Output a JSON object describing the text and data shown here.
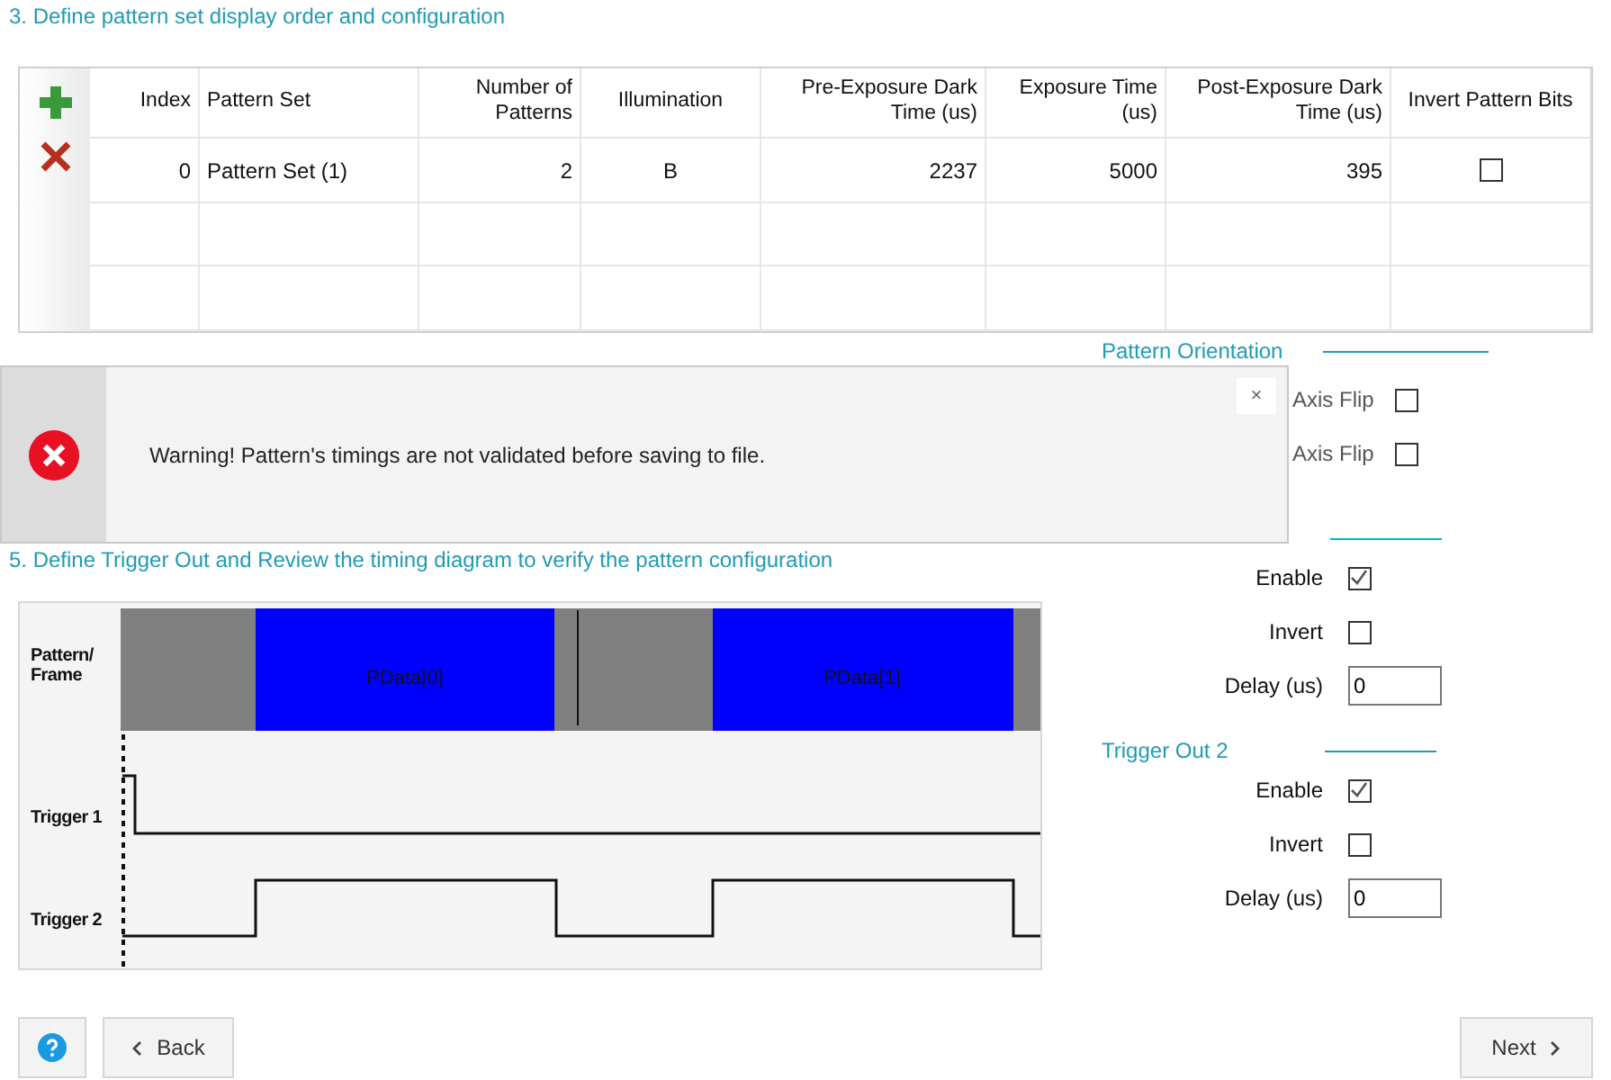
{
  "section3": {
    "title": "3. Define pattern set display order and configuration"
  },
  "pattern_table": {
    "columns": [
      "Index",
      "Pattern Set",
      "Number of Patterns",
      "Illumination",
      "Pre-Exposure Dark Time (us)",
      "Exposure Time (us)",
      "Post-Exposure Dark Time (us)",
      "Invert Pattern Bits"
    ],
    "rows": [
      {
        "index": "0",
        "pattern_set": "Pattern Set (1)",
        "number_of_patterns": "2",
        "illumination": "B",
        "pre_exposure": "2237",
        "exposure": "5000",
        "post_exposure": "395",
        "invert_pattern_bits": false
      }
    ]
  },
  "pattern_orientation": {
    "title": "Pattern Orientation",
    "flips": [
      {
        "label": "Axis Flip",
        "checked": false
      },
      {
        "label": "Axis Flip",
        "checked": false
      }
    ]
  },
  "warning": {
    "message": "Warning! Pattern's timings are not validated before saving to file.",
    "close": "×"
  },
  "section5": {
    "title": "5. Define Trigger Out and Review the timing diagram to verify the pattern configuration"
  },
  "timing_diagram": {
    "frame_label": "Pattern/ Frame",
    "blocks": [
      "PData[0]",
      "PData[1]"
    ],
    "triggers": [
      "Trigger 1",
      "Trigger 2"
    ]
  },
  "trigger_outs": [
    {
      "enable_label": "Enable",
      "enable": true,
      "invert_label": "Invert",
      "invert": false,
      "delay_label": "Delay (us)",
      "delay": "0"
    },
    {
      "title": "Trigger Out 2",
      "enable_label": "Enable",
      "enable": true,
      "invert_label": "Invert",
      "invert": false,
      "delay_label": "Delay (us)",
      "delay": "0"
    }
  ],
  "buttons": {
    "back": "Back",
    "next": "Next"
  }
}
